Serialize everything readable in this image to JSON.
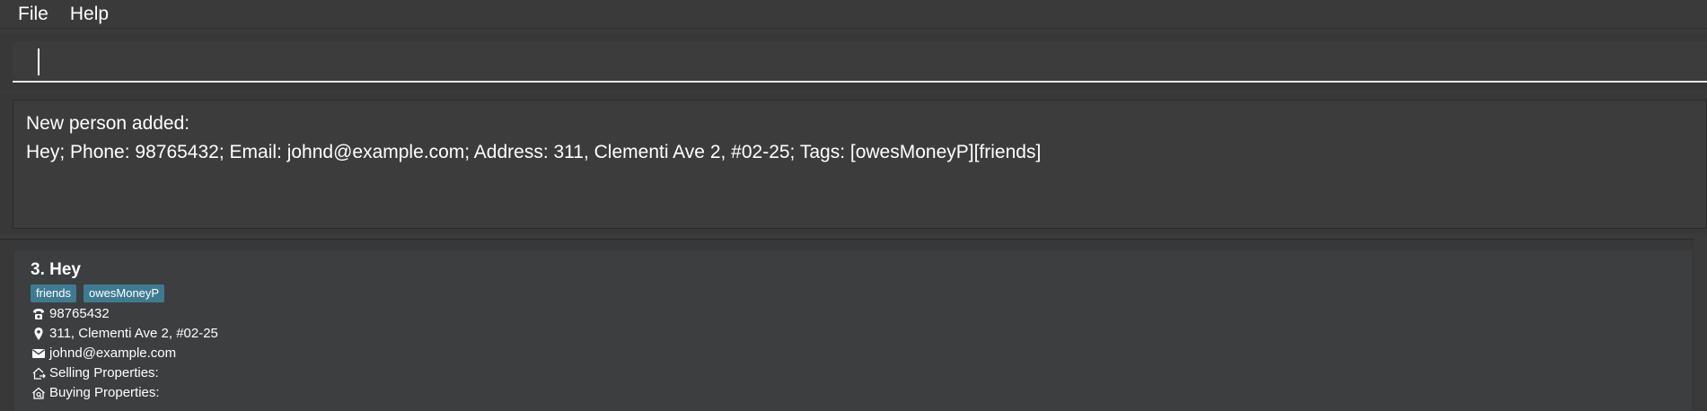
{
  "menu": {
    "file_label": "File",
    "help_label": "Help"
  },
  "command": {
    "value": "",
    "placeholder": ""
  },
  "result": {
    "text": "New person added:\nHey; Phone: 98765432; Email: johnd@example.com; Address: 311, Clementi Ave 2, #02-25; Tags: [owesMoneyP][friends]"
  },
  "person_list": {
    "cards": [
      {
        "title": "3. Hey",
        "tags": [
          "friends",
          "owesMoneyP"
        ],
        "phone": "98765432",
        "address": "311, Clementi Ave 2, #02-25",
        "email": "johnd@example.com",
        "selling_label": "Selling Properties:",
        "buying_label": "Buying Properties:"
      }
    ]
  },
  "icons": {
    "phone": "phone-icon",
    "address": "location-pin-icon",
    "email": "mail-icon",
    "selling": "house-out-icon",
    "buying": "house-search-icon"
  },
  "colors": {
    "background": "#3a3a3a",
    "tag": "#3e7b91",
    "text": "#ffffff"
  }
}
